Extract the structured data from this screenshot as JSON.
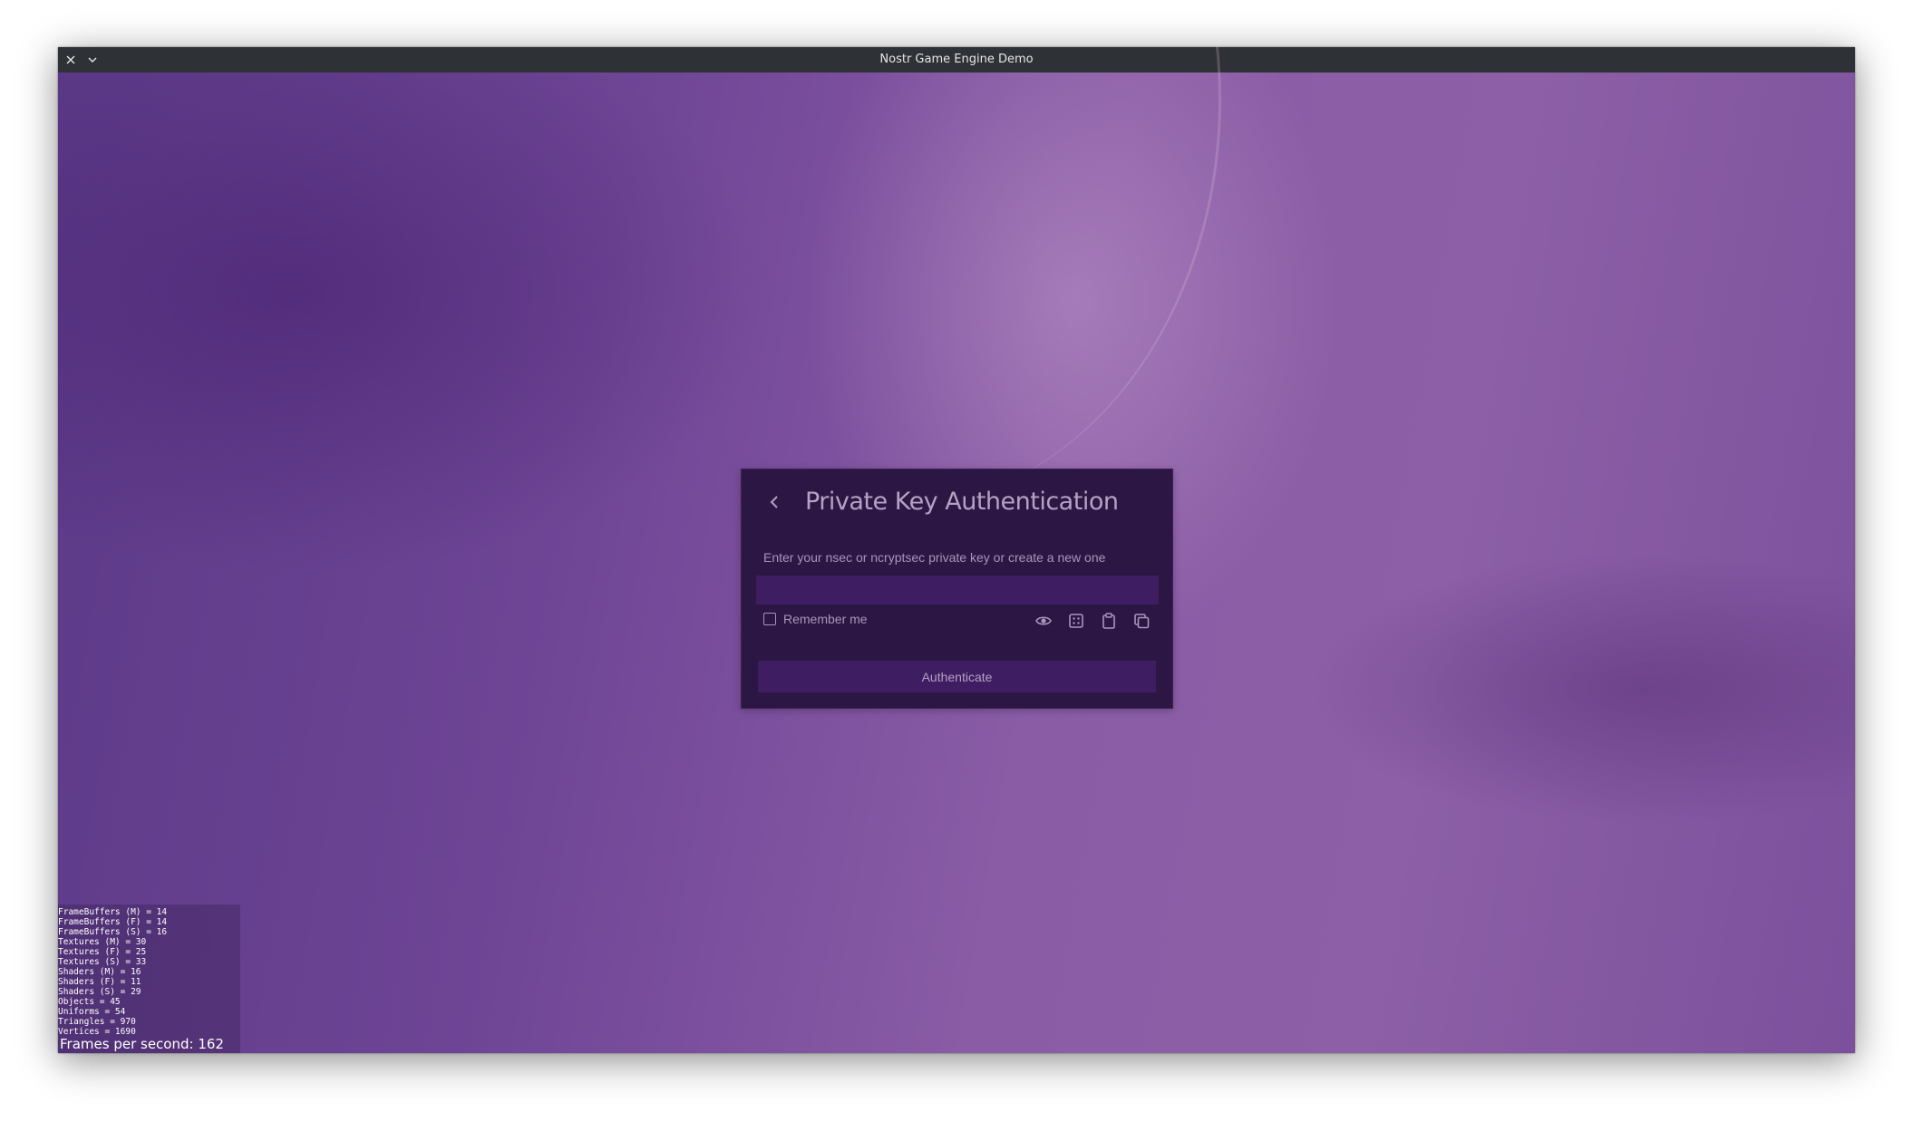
{
  "window": {
    "title": "Nostr Game Engine Demo",
    "close_icon": "close-icon",
    "menu_icon": "chevron-down-icon"
  },
  "dialog": {
    "back_icon": "chevron-left-icon",
    "title": "Private Key Authentication",
    "subtitle": "Enter your nsec or ncryptsec private key or create a new one",
    "key_input": {
      "value": "",
      "placeholder": ""
    },
    "remember_label": "Remember me",
    "remember_checked": false,
    "icons": [
      "eye-icon",
      "dice-icon",
      "paste-icon",
      "copy-icon"
    ],
    "authenticate_label": "Authenticate"
  },
  "stats": {
    "lines": [
      "FrameBuffers (M) = 14",
      "FrameBuffers (F) = 14",
      "FrameBuffers (S) = 16",
      "Textures (M) = 30",
      "Textures (F) = 25",
      "Textures (S) = 33",
      "Shaders (M) = 16",
      "Shaders (F) = 11",
      "Shaders (S) = 29",
      "Objects = 45",
      "Uniforms = 54",
      "Triangles = 970",
      "Vertices = 1690"
    ],
    "fps_text": "Frames per second: 162"
  },
  "colors": {
    "titlebar": "#2e3136",
    "dialog_bg": "#2c1644",
    "input_bg": "#3e1d62",
    "text_muted": "#a995bd",
    "background_purple": "#7a4f9c"
  }
}
